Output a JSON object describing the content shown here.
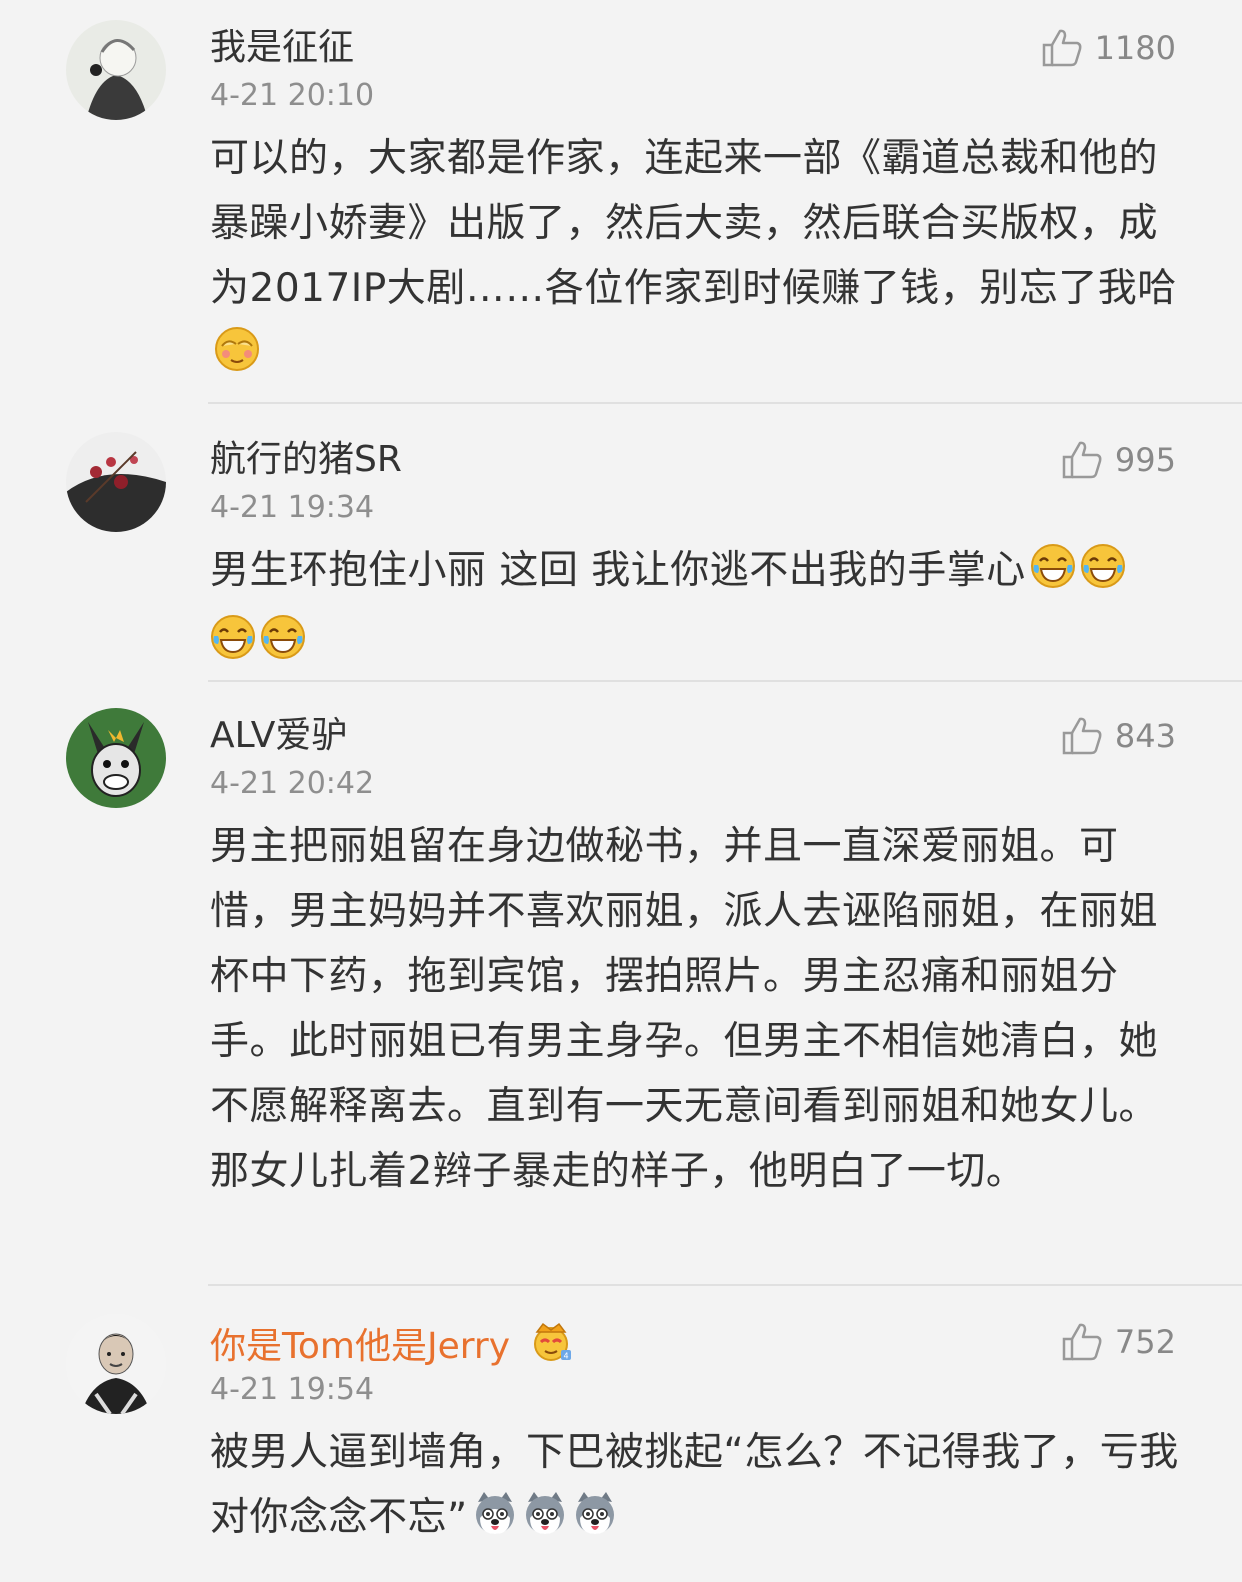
{
  "comments": [
    {
      "name": "我是征征",
      "time": "4-21 20:10",
      "likes": "1180",
      "text": "可以的，大家都是作家，连起来一部《霸道总裁和他的暴躁小娇妻》出版了，然后大卖，然后联合买版权，成为2017IP大剧……各位作家到时候赚了钱，别忘了我哈",
      "emojis": [
        "shy-face-emoji"
      ]
    },
    {
      "name": "航行的猪SR",
      "time": "4-21 19:34",
      "likes": "995",
      "text": "男生环抱住小丽 这回 我让你逃不出我的手掌心",
      "emojis": [
        "laugh-cry-emoji",
        "laugh-cry-emoji",
        "laugh-cry-emoji",
        "laugh-cry-emoji"
      ]
    },
    {
      "name": "ALV爱驴",
      "time": "4-21 20:42",
      "likes": "843",
      "text": "男主把丽姐留在身边做秘书，并且一直深爱丽姐。可惜，男主妈妈并不喜欢丽姐，派人去诬陷丽姐，在丽姐杯中下药，拖到宾馆，摆拍照片。男主忍痛和丽姐分手。此时丽姐已有男主身孕。但男主不相信她清白，她不愿解释离去。直到有一天无意间看到丽姐和她女儿。那女儿扎着2辫子暴走的样子，他明白了一切。",
      "emojis": []
    },
    {
      "name": "你是Tom他是Jerry",
      "time": "4-21 19:54",
      "likes": "752",
      "text": "被男人逼到墙角，下巴被挑起“怎么？不记得我了，亏我对你念念不忘”",
      "emojis": [
        "husky-emoji",
        "husky-emoji",
        "husky-emoji"
      ]
    }
  ],
  "icons": {
    "like": "thumbs-up-icon",
    "vip_badge": "crown-badge-icon"
  },
  "colors": {
    "background": "#f3f3f3",
    "vip_name": "#e8712e",
    "time": "#8e8e8e"
  }
}
